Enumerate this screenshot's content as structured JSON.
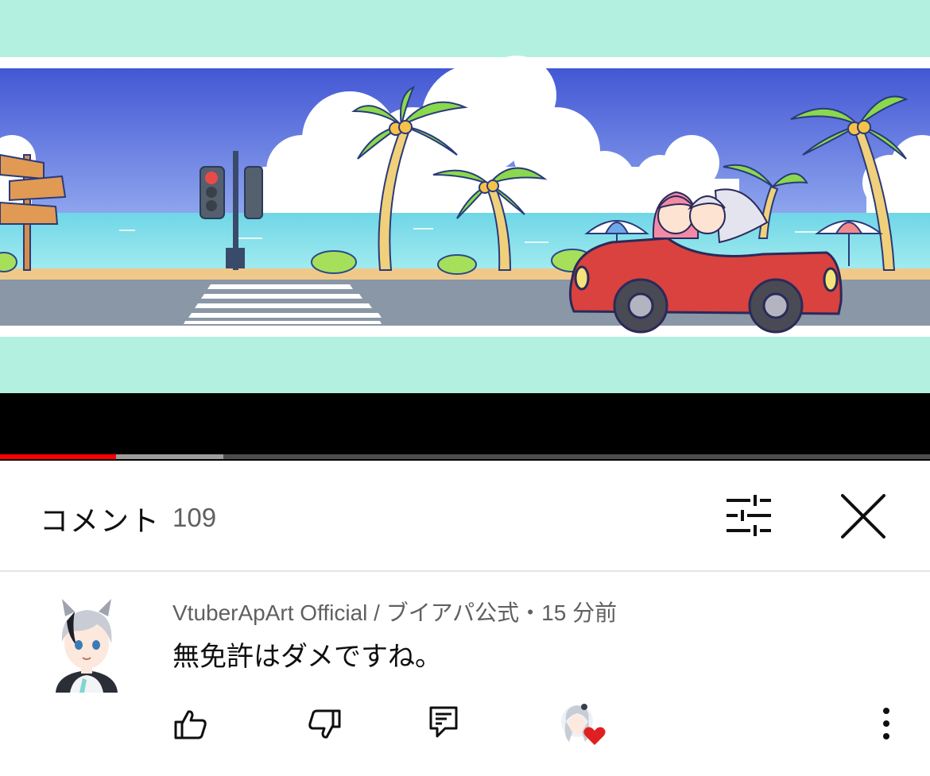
{
  "player": {
    "progress_played_fraction": 0.125,
    "progress_buffered_fraction": 0.24,
    "colors": {
      "played": "#ff0000",
      "buffered": "#9e9e9e",
      "track": "#4d4d4d",
      "frame": "#b3f0e0"
    }
  },
  "comments": {
    "title": "コメント",
    "count": "109",
    "filter_icon": "sort-filter-icon",
    "close_icon": "close-icon"
  },
  "comment": {
    "author": "VtuberApArt Official / ブイアパ公式",
    "separator": "・",
    "time": "15 分前",
    "text": "無免許はダメですね。",
    "actions": {
      "like_icon": "thumbs-up-icon",
      "dislike_icon": "thumbs-down-icon",
      "reply_icon": "reply-icon",
      "heart_icon": "creator-heart-icon",
      "more_icon": "more-vert-icon"
    },
    "heart_color": "#e02020"
  }
}
